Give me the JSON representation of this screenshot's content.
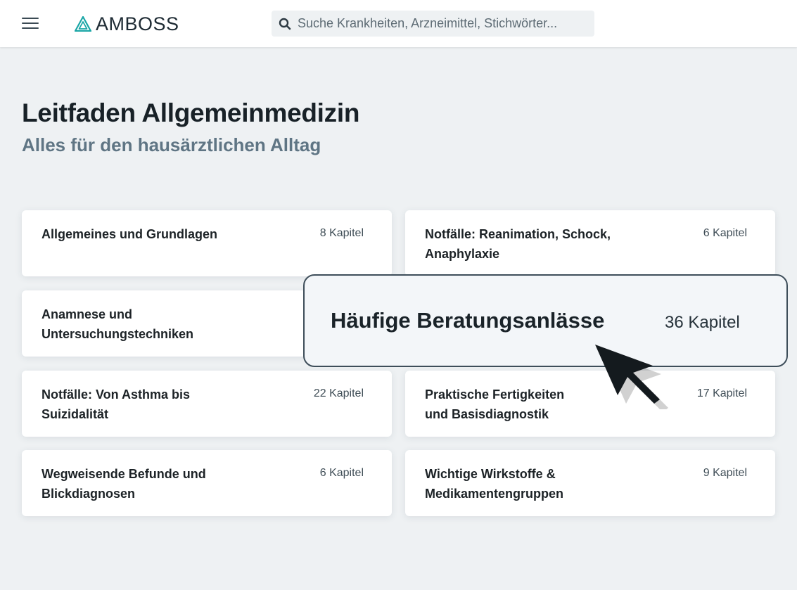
{
  "header": {
    "menu_icon": "hamburger-menu-icon",
    "logo_icon": "amboss-triangle-icon",
    "logo_text": "AMBOSS",
    "brand_color": "#1aa6a6",
    "search": {
      "icon": "search-icon",
      "placeholder": "Suche Krankheiten, Arzneimittel, Stichwörter..."
    }
  },
  "main": {
    "title": "Leitfaden Allgemeinmedizin",
    "subtitle": "Alles für den hausärztlichen Alltag",
    "cards": [
      {
        "title": "Allgemeines und Grundlagen",
        "count": "8 Kapitel"
      },
      {
        "title": "Notfälle: Reanimation, Schock, Anaphylaxie",
        "count": "6 Kapitel"
      },
      {
        "title": "Anamnese und Untersuchungstechniken",
        "count": ""
      },
      {
        "title": "Notfälle: Von Asthma bis Suizidalität",
        "count": "22 Kapitel"
      },
      {
        "title": "Praktische Fertigkeiten und Basisdiagnostik",
        "count": "17 Kapitel"
      },
      {
        "title": "Wegweisende Befunde und Blickdiagnosen",
        "count": "6 Kapitel"
      },
      {
        "title": "Wichtige Wirkstoffe & Medikamentengruppen",
        "count": "9 Kapitel"
      }
    ],
    "highlighted_card": {
      "title": "Häufige Beratungsanlässe",
      "count": "36 Kapitel"
    }
  },
  "overlay": {
    "cursor_icon": "mouse-pointer-icon"
  }
}
